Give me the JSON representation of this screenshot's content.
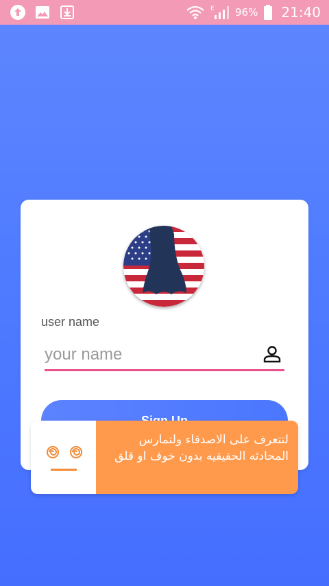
{
  "status_bar": {
    "battery": "96%",
    "time": "21:40",
    "icons": [
      "upload-icon",
      "image-icon",
      "download-icon",
      "wifi-icon",
      "signal-icon",
      "battery-icon"
    ]
  },
  "login": {
    "label": "user name",
    "username_placeholder": "your name",
    "username_value": "",
    "signup_label": "Sign Up"
  },
  "toast": {
    "message": "لتتعرف على الاصدقاء ولتمارس المحادثه الحقيقيه بدون خوف او قلق",
    "emoji": "dizzy-face-icon"
  },
  "colors": {
    "background": "#4f7cff",
    "status_bar": "#f39ab7",
    "underline": "#e8538b",
    "toast": "#ff9a4d"
  }
}
